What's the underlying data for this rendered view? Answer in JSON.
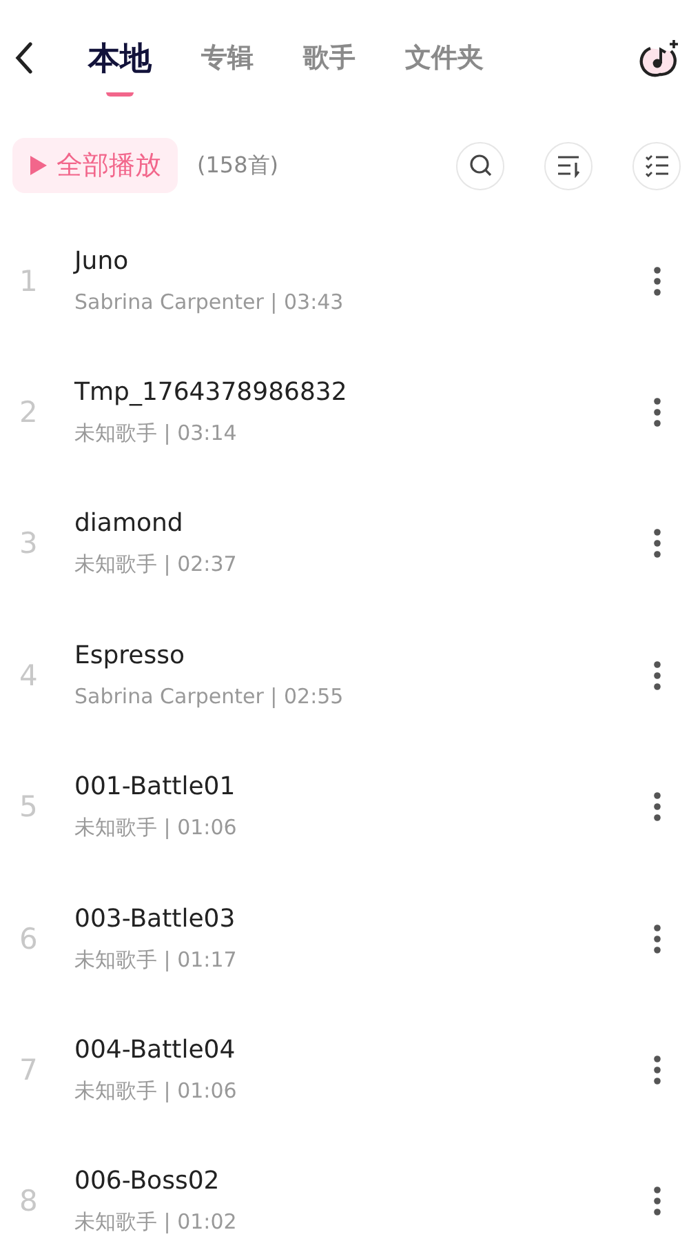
{
  "tabs": [
    {
      "label": "本地",
      "selected": true
    },
    {
      "label": "专辑",
      "selected": false
    },
    {
      "label": "歌手",
      "selected": false
    },
    {
      "label": "文件夹",
      "selected": false
    }
  ],
  "toolbar": {
    "play_all": "全部播放",
    "count": "(158首)"
  },
  "songs": [
    {
      "index": "1",
      "title": "Juno",
      "subtitle": "Sabrina Carpenter | 03:43"
    },
    {
      "index": "2",
      "title": "Tmp_1764378986832",
      "subtitle": "未知歌手 | 03:14"
    },
    {
      "index": "3",
      "title": "diamond",
      "subtitle": "未知歌手 | 02:37"
    },
    {
      "index": "4",
      "title": "Espresso",
      "subtitle": "Sabrina Carpenter | 02:55"
    },
    {
      "index": "5",
      "title": "001-Battle01",
      "subtitle": "未知歌手 | 01:06"
    },
    {
      "index": "6",
      "title": "003-Battle03",
      "subtitle": "未知歌手 | 01:17"
    },
    {
      "index": "7",
      "title": "004-Battle04",
      "subtitle": "未知歌手 | 01:06"
    },
    {
      "index": "8",
      "title": "006-Boss02",
      "subtitle": "未知歌手 | 01:02"
    }
  ]
}
